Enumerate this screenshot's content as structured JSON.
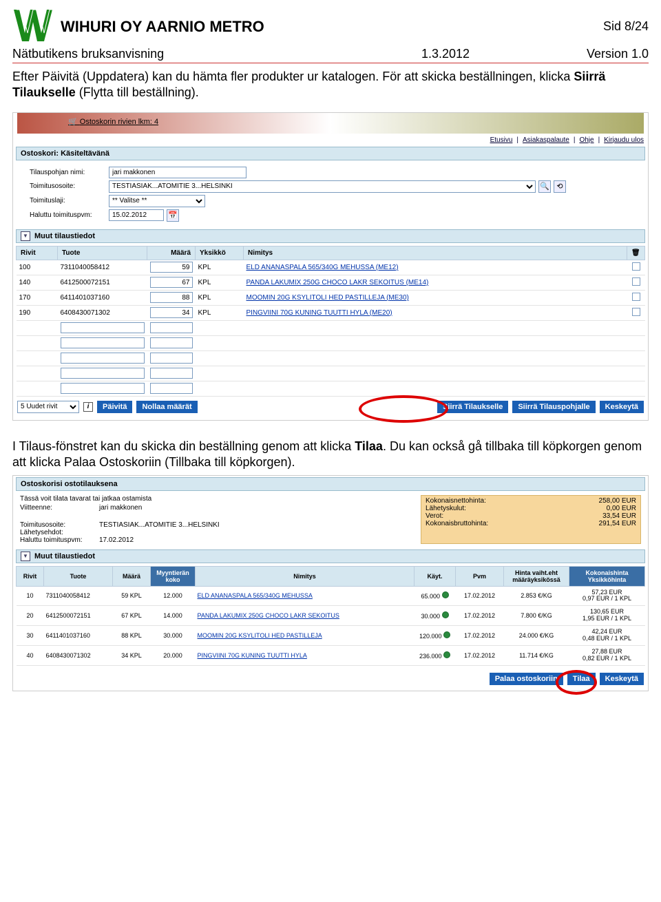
{
  "header": {
    "company": "WIHURI OY AARNIO METRO",
    "page_indicator": "Sid 8/24",
    "subtitle_left": "Nätbutikens bruksanvisning",
    "subtitle_mid": "1.3.2012",
    "subtitle_right": "Version 1.0"
  },
  "para1_a": "Efter Päivitä (Uppdatera) kan du hämta fler produkter ur katalogen. För att skicka beställningen, klicka ",
  "para1_b": "Siirrä Tilaukselle",
  "para1_c": " (Flytta till beställning).",
  "shot1": {
    "cart_line": "Ostoskorin rivien lkm: 4",
    "links": [
      "Etusivu",
      "Asiakaspalaute",
      "Ohje",
      "Kirjaudu ulos"
    ],
    "panel_title": "Ostoskori: Käsiteltävänä",
    "fields": {
      "nimi_lbl": "Tilauspohjan nimi:",
      "nimi_val": "jari makkonen",
      "osoite_lbl": "Toimitusosoite:",
      "osoite_val": "TESTIASIAK...ATOMITIE 3...HELSINKI",
      "laji_lbl": "Toimituslaji:",
      "laji_val": "** Valitse **",
      "pvm_lbl": "Haluttu toimituspvm:",
      "pvm_val": "15.02.2012"
    },
    "muut": "Muut tilaustiedot",
    "cols": {
      "rivit": "Rivit",
      "tuote": "Tuote",
      "maara": "Määrä",
      "yksikko": "Yksikkö",
      "nimitys": "Nimitys"
    },
    "rows": [
      {
        "r": "100",
        "tuote": "7311040058412",
        "maara": "59",
        "yks": "KPL",
        "nim": "ELD ANANASPALA 565/340G MEHUSSA (ME12)"
      },
      {
        "r": "140",
        "tuote": "6412500072151",
        "maara": "67",
        "yks": "KPL",
        "nim": "PANDA LAKUMIX 250G CHOCO LAKR SEKOITUS (ME14)"
      },
      {
        "r": "170",
        "tuote": "6411401037160",
        "maara": "88",
        "yks": "KPL",
        "nim": "MOOMIN 20G KSYLITOLI HED PASTILLEJA (ME30)"
      },
      {
        "r": "190",
        "tuote": "6408430071302",
        "maara": "34",
        "yks": "KPL",
        "nim": "PINGVIINI 70G KUNING TUUTTI HYLA (ME20)"
      }
    ],
    "uudet": "5 Uudet rivit",
    "btn_paivita": "Päivitä",
    "btn_nollaa": "Nollaa määrät",
    "btn_siirra_tilaus": "Siirrä Tilaukselle",
    "btn_siirra_pohja": "Siirrä Tilauspohjalle",
    "btn_keskeyta": "Keskeytä"
  },
  "para2_a": "I Tilaus-fönstret kan du skicka din beställning genom att klicka ",
  "para2_b": "Tilaa",
  "para2_c": ". Du kan också gå tillbaka till köpkorgen genom att klicka Palaa Ostoskoriin (Tillbaka till köpkorgen).",
  "shot2": {
    "panel_title": "Ostoskorisi ostotilauksena",
    "info1": "Tässä voit tilata tavarat tai jatkaa ostamista",
    "viite_lbl": "Viitteenne:",
    "viite_val": "jari makkonen",
    "sum": {
      "netto_lbl": "Kokonaisnettohinta:",
      "netto_val": "258,00 EUR",
      "lah_lbl": "Lähetyskulut:",
      "lah_val": "0,00 EUR",
      "verot_lbl": "Verot:",
      "verot_val": "33,54 EUR",
      "brutto_lbl": "Kokonaisbruttohinta:",
      "brutto_val": "291,54 EUR"
    },
    "osoite_lbl": "Toimitusosoite:",
    "osoite_val": "TESTIASIAK...ATOMITIE 3...HELSINKI",
    "ehdot_lbl": "Lähetysehdot:",
    "pvm_lbl": "Haluttu toimituspvm:",
    "pvm_val": "17.02.2012",
    "muut": "Muut tilaustiedot",
    "cols": {
      "rivit": "Rivit",
      "tuote": "Tuote",
      "maara": "Määrä",
      "myynti": "Myyntierän koko",
      "nimitys": "Nimitys",
      "kayt": "Käyt.",
      "pvm": "Pvm",
      "hintaeht": "Hinta vaiht.eht määräyksikössä",
      "kok": "Kokonaishinta Yksikköhinta"
    },
    "rows": [
      {
        "r": "10",
        "tuote": "7311040058412",
        "maara": "59 KPL",
        "myynti": "12.000",
        "nim": "ELD ANANASPALA 565/340G MEHUSSA",
        "kayt": "65.000",
        "pvm": "17.02.2012",
        "heht": "2.853 €/KG",
        "kok1": "57,23 EUR",
        "kok2": "0,97 EUR / 1 KPL"
      },
      {
        "r": "20",
        "tuote": "6412500072151",
        "maara": "67 KPL",
        "myynti": "14.000",
        "nim": "PANDA LAKUMIX 250G CHOCO LAKR SEKOITUS",
        "kayt": "30.000",
        "pvm": "17.02.2012",
        "heht": "7.800 €/KG",
        "kok1": "130,65 EUR",
        "kok2": "1,95 EUR / 1 KPL"
      },
      {
        "r": "30",
        "tuote": "6411401037160",
        "maara": "88 KPL",
        "myynti": "30.000",
        "nim": "MOOMIN 20G KSYLITOLI HED PASTILLEJA",
        "kayt": "120.000",
        "pvm": "17.02.2012",
        "heht": "24.000 €/KG",
        "kok1": "42,24 EUR",
        "kok2": "0,48 EUR / 1 KPL"
      },
      {
        "r": "40",
        "tuote": "6408430071302",
        "maara": "34 KPL",
        "myynti": "20.000",
        "nim": "PINGVIINI 70G KUNING TUUTTI HYLA",
        "kayt": "236.000",
        "pvm": "17.02.2012",
        "heht": "11.714 €/KG",
        "kok1": "27,88 EUR",
        "kok2": "0,82 EUR / 1 KPL"
      }
    ],
    "btn_palaa": "Palaa ostoskoriin",
    "btn_tilaa": "Tilaa",
    "btn_keskeyta": "Keskeytä"
  }
}
